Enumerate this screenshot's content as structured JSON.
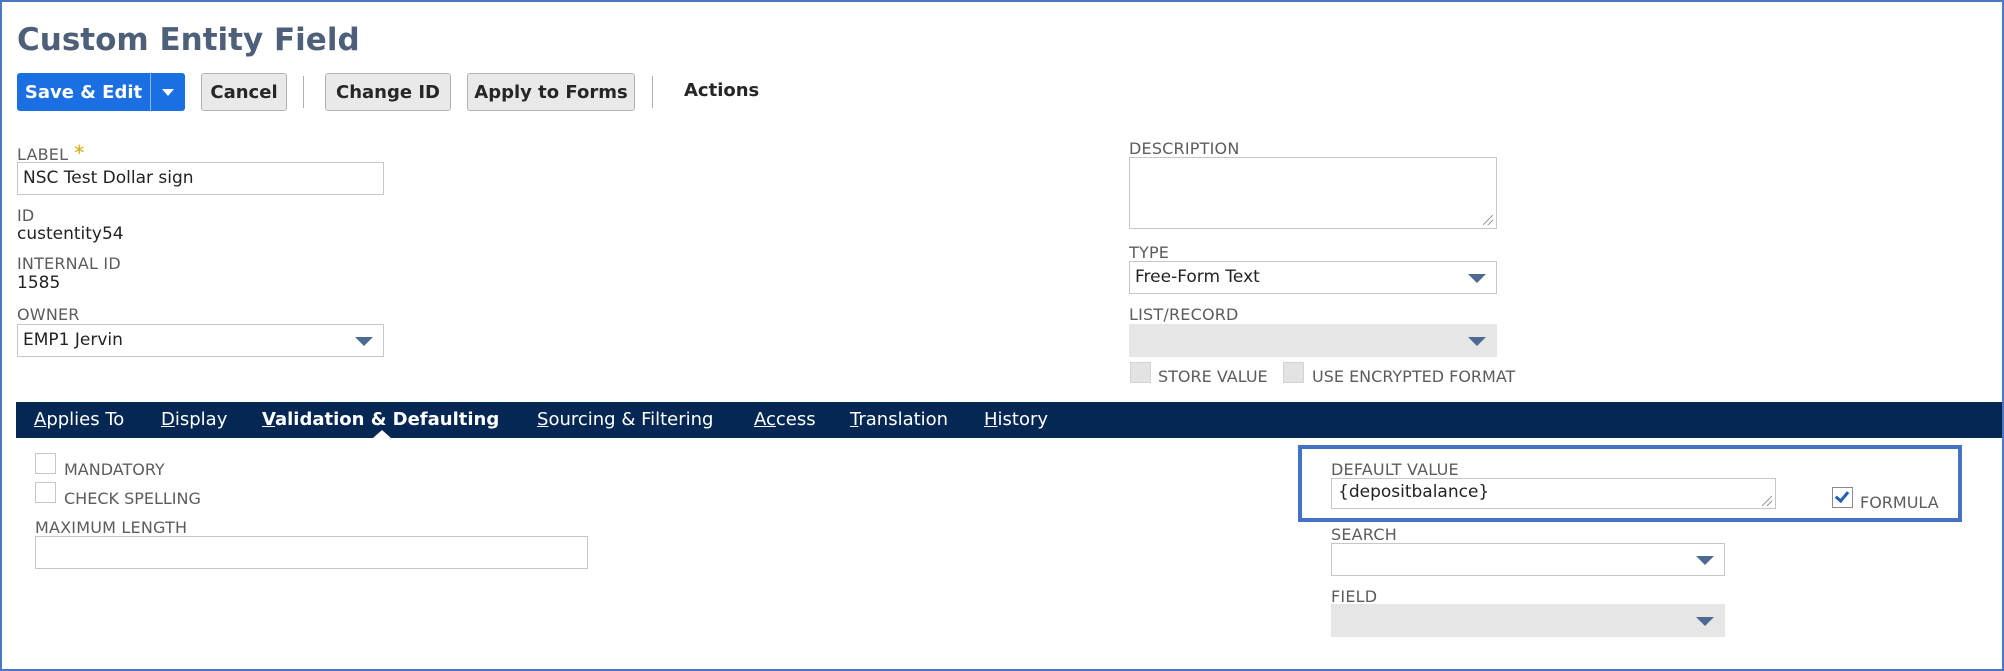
{
  "page": {
    "title": "Custom Entity Field"
  },
  "toolbar": {
    "save_edit": "Save & Edit",
    "cancel": "Cancel",
    "change_id": "Change ID",
    "apply_to_forms": "Apply to Forms",
    "actions": "Actions"
  },
  "fields": {
    "label": {
      "label": "LABEL",
      "required_mark": "*",
      "value": "NSC Test Dollar sign"
    },
    "id": {
      "label": "ID",
      "value": "custentity54"
    },
    "internal_id": {
      "label": "INTERNAL ID",
      "value": "1585"
    },
    "owner": {
      "label": "OWNER",
      "value": "EMP1 Jervin"
    },
    "description": {
      "label": "DESCRIPTION",
      "value": ""
    },
    "type": {
      "label": "TYPE",
      "value": "Free-Form Text"
    },
    "list_record": {
      "label": "LIST/RECORD",
      "value": ""
    },
    "store_value": {
      "label": "STORE VALUE",
      "checked": false
    },
    "use_encrypted": {
      "label": "USE ENCRYPTED FORMAT",
      "checked": false
    }
  },
  "tabs": [
    {
      "key": "A",
      "rest": "pplies To",
      "active": false
    },
    {
      "key": "D",
      "rest": "isplay",
      "active": false
    },
    {
      "key": "V",
      "rest": "alidation & Defaulting",
      "active": true
    },
    {
      "key": "S",
      "rest": "ourcing & Filtering",
      "active": false
    },
    {
      "key": "Ac",
      "rest": "cess",
      "active": false
    },
    {
      "key": "T",
      "rest": "ranslation",
      "active": false
    },
    {
      "key": "H",
      "rest": "istory",
      "active": false
    }
  ],
  "validation": {
    "mandatory": {
      "label": "MANDATORY",
      "checked": false
    },
    "check_spelling": {
      "label": "CHECK SPELLING",
      "checked": false
    },
    "max_length": {
      "label": "MAXIMUM LENGTH",
      "value": ""
    },
    "default_value": {
      "label": "DEFAULT VALUE",
      "value": "{depositbalance}"
    },
    "formula": {
      "label": "FORMULA",
      "checked": true
    },
    "search": {
      "label": "SEARCH",
      "value": ""
    },
    "field": {
      "label": "FIELD",
      "value": ""
    }
  },
  "colors": {
    "primary": "#1a6fe3",
    "tabbar": "#042754",
    "highlight": "#4472c4",
    "title": "#4d5f79"
  }
}
